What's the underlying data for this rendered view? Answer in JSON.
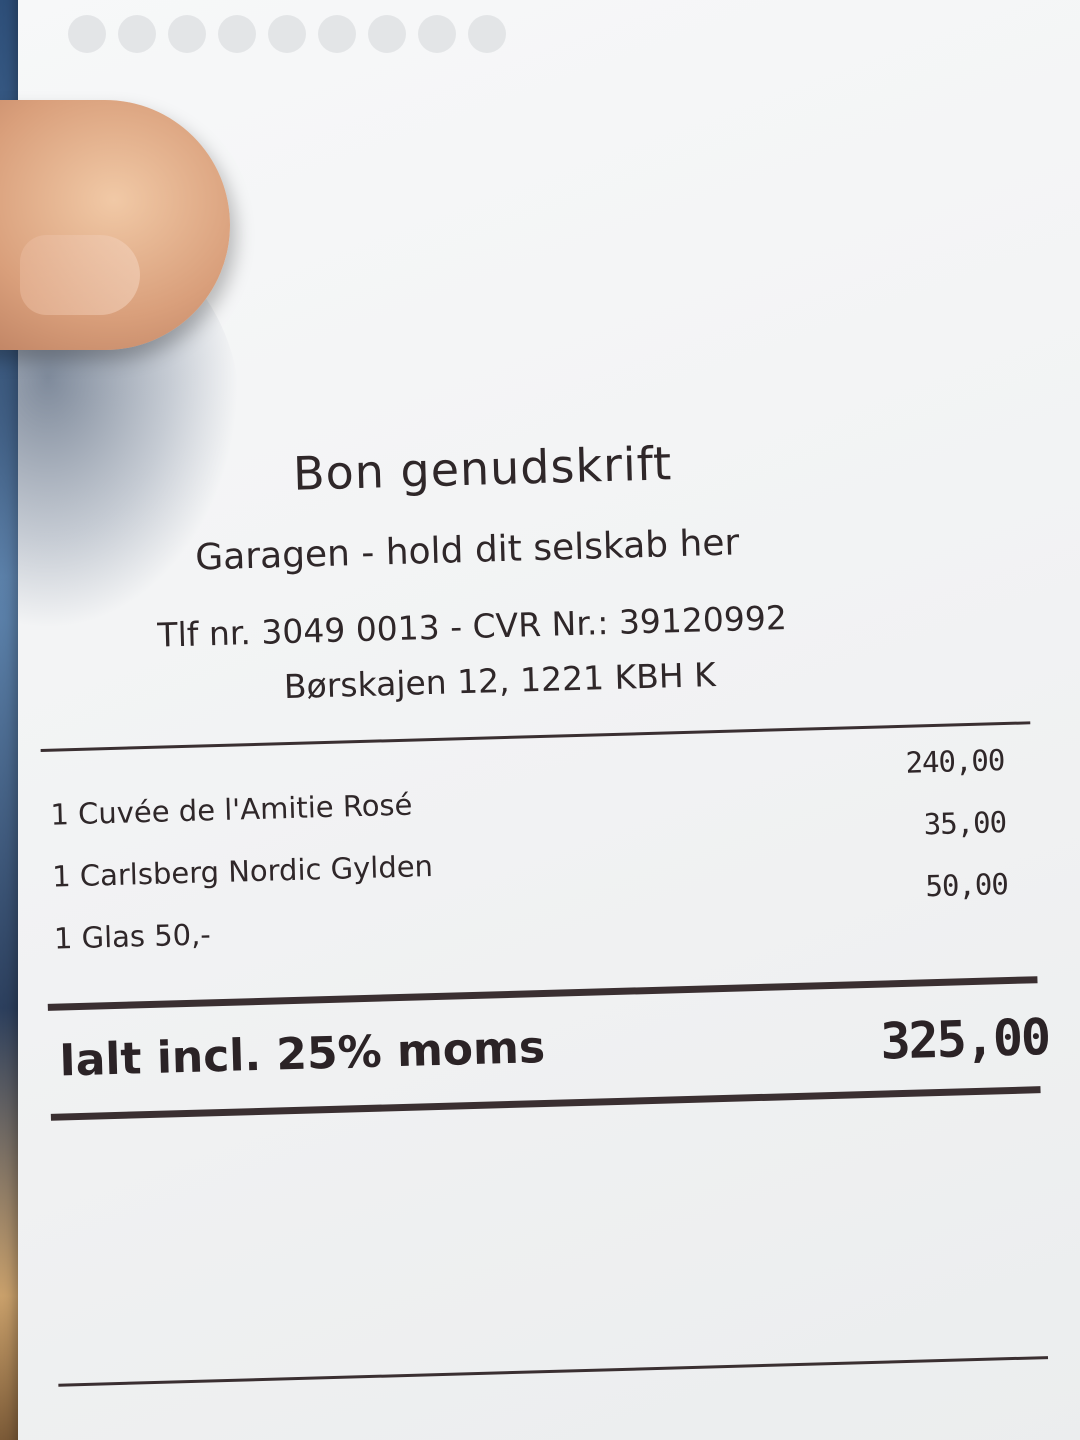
{
  "receipt": {
    "title": "Bon genudskrift",
    "venue": "Garagen - hold dit selskab her",
    "contact_line": "Tlf nr. 3049 0013 - CVR Nr.: 39120992",
    "address": "Børskajen 12, 1221 KBH K",
    "items": [
      {
        "name": "1 Cuvée de l'Amitie Rosé",
        "price": "240,00"
      },
      {
        "name": "1 Carlsberg Nordic Gylden",
        "price": "35,00"
      },
      {
        "name": "1 Glas 50,-",
        "price": "50,00"
      }
    ],
    "total_label": "Ialt incl. 25% moms",
    "total_amount": "325,00"
  },
  "colors": {
    "paper": "#f2f3f4",
    "ink": "#2f2729",
    "skin": "#d99f7b"
  }
}
